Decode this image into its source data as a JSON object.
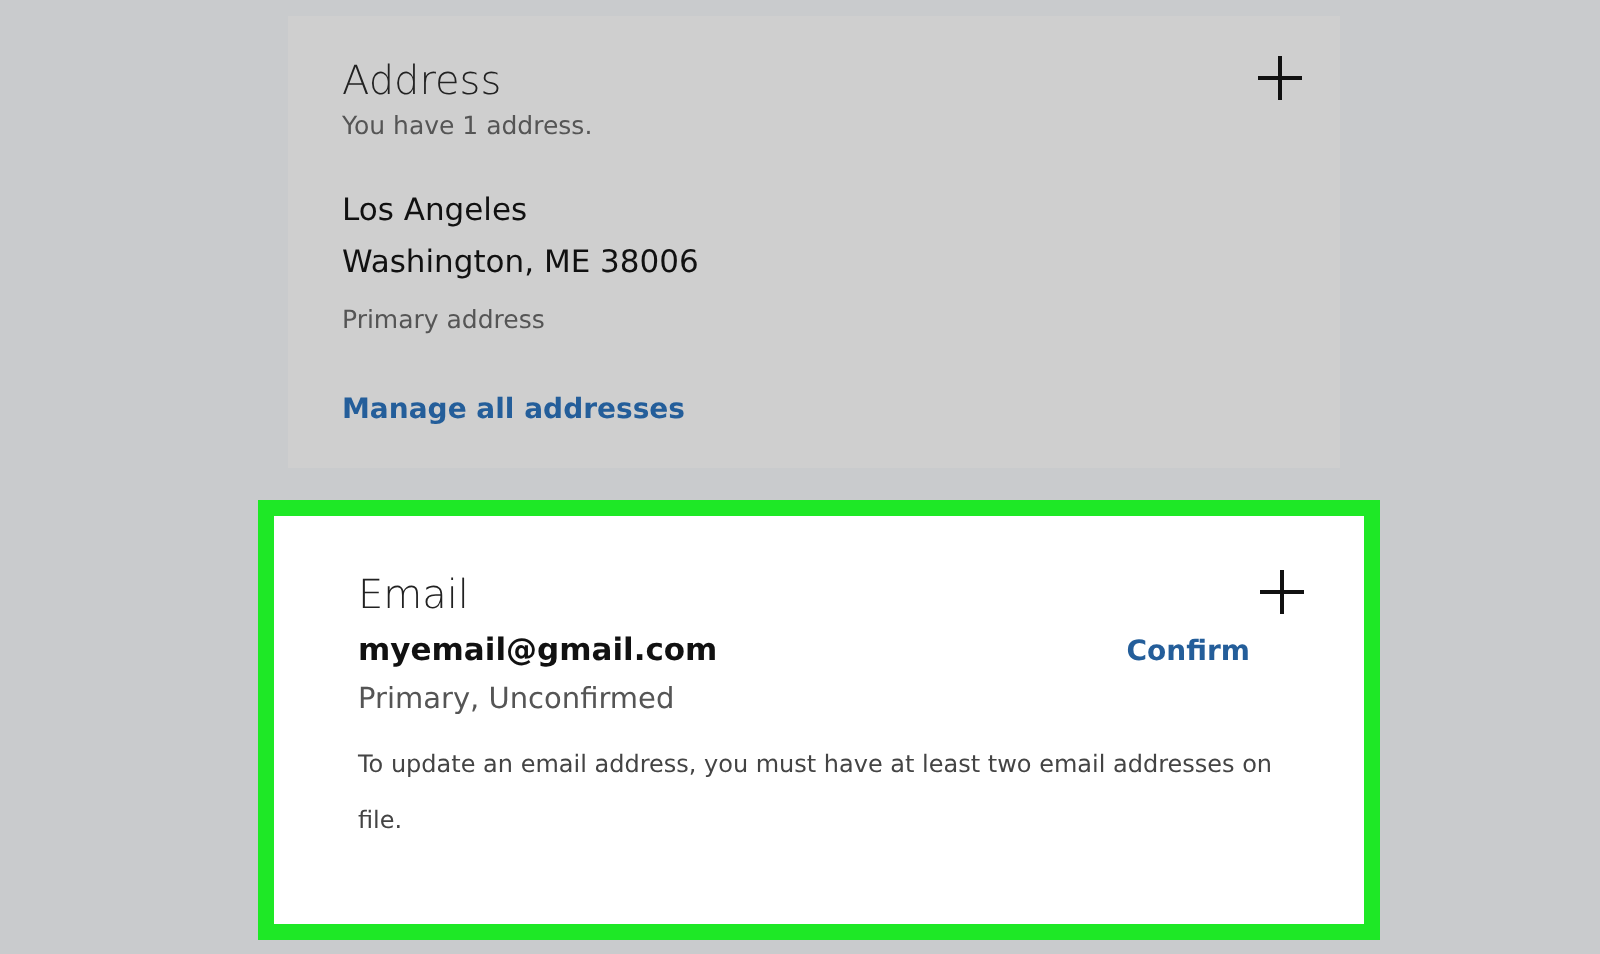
{
  "address_card": {
    "title": "Address",
    "subtitle": "You have 1 address.",
    "lines": [
      "Los Angeles",
      "Washington, ME 38006"
    ],
    "note": "Primary address",
    "link": "Manage all addresses",
    "highlighted": false
  },
  "email_card": {
    "title": "Email",
    "email": "myemail@gmail.com",
    "action": "Confirm",
    "status": "Primary, Unconfirmed",
    "info": "To update an email address, you must have at least two email addresses on file.",
    "highlighted": true
  }
}
